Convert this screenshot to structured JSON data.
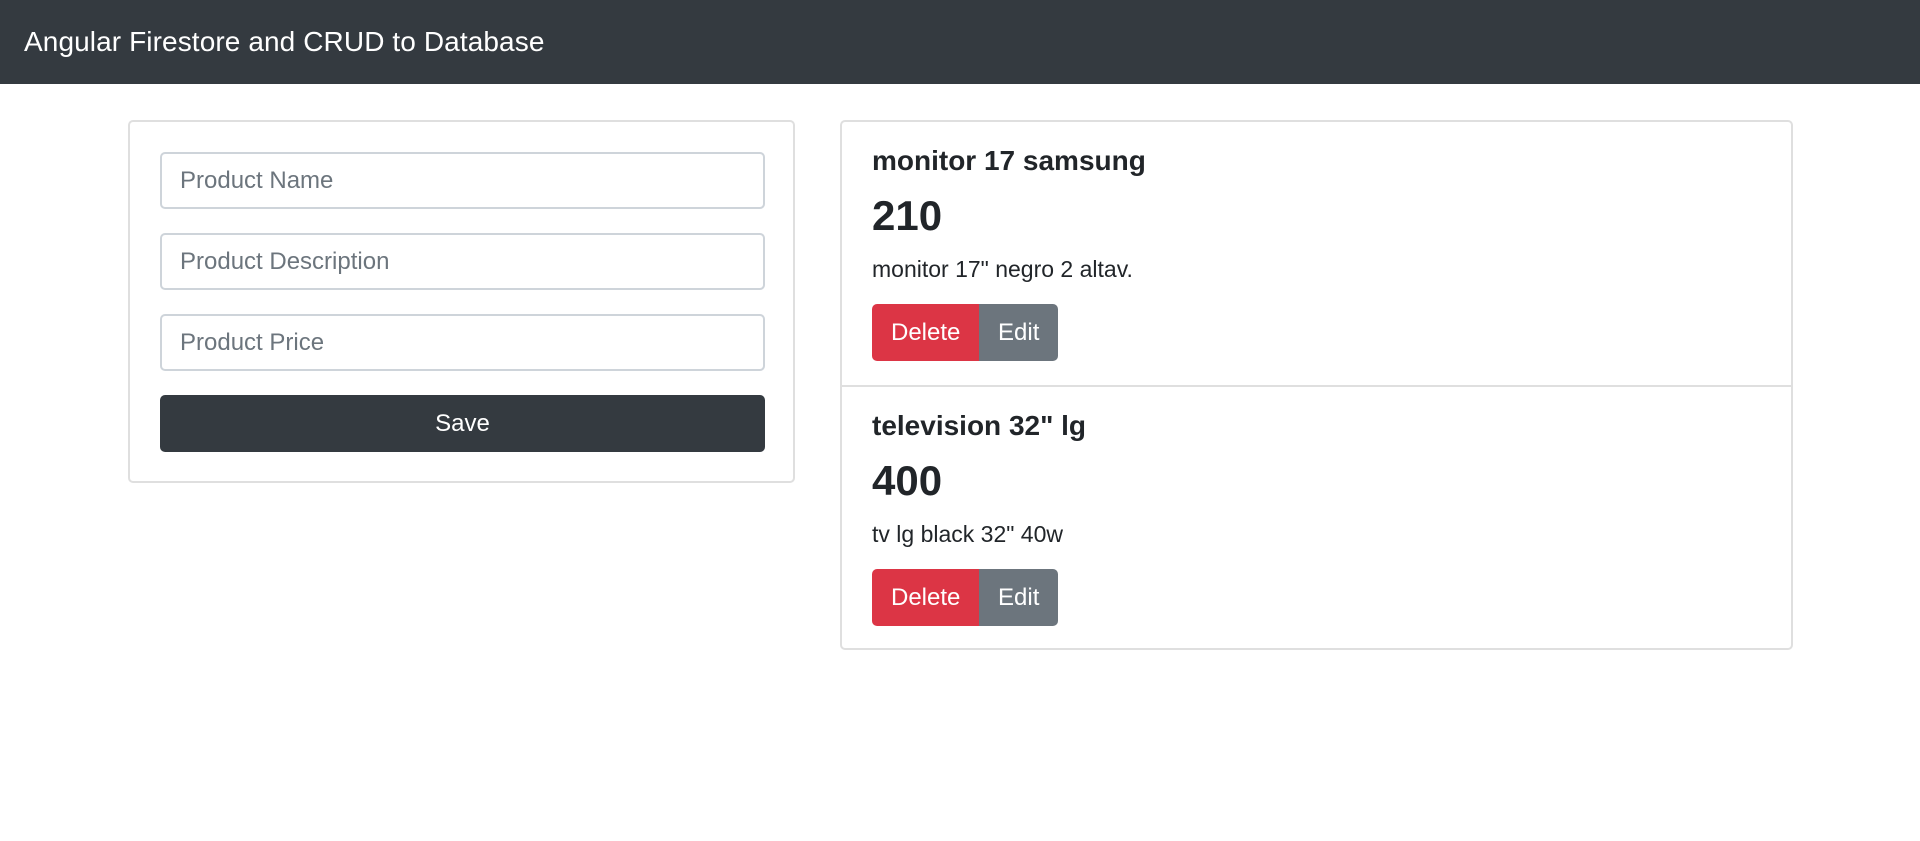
{
  "navbar": {
    "brand": "Angular Firestore and CRUD to Database"
  },
  "form": {
    "name_placeholder": "Product Name",
    "description_placeholder": "Product Description",
    "price_placeholder": "Product Price",
    "save_label": "Save"
  },
  "products": [
    {
      "name": "monitor 17 samsung",
      "price": "210",
      "description": "monitor 17\" negro 2 altav.",
      "delete_label": "Delete",
      "edit_label": "Edit"
    },
    {
      "name": "television 32\" lg",
      "price": "400",
      "description": "tv lg black 32\" 40w",
      "delete_label": "Delete",
      "edit_label": "Edit"
    }
  ],
  "colors": {
    "navbar": "#343a40",
    "delete": "#dc3545",
    "edit": "#6c757d",
    "save": "#343a40"
  }
}
